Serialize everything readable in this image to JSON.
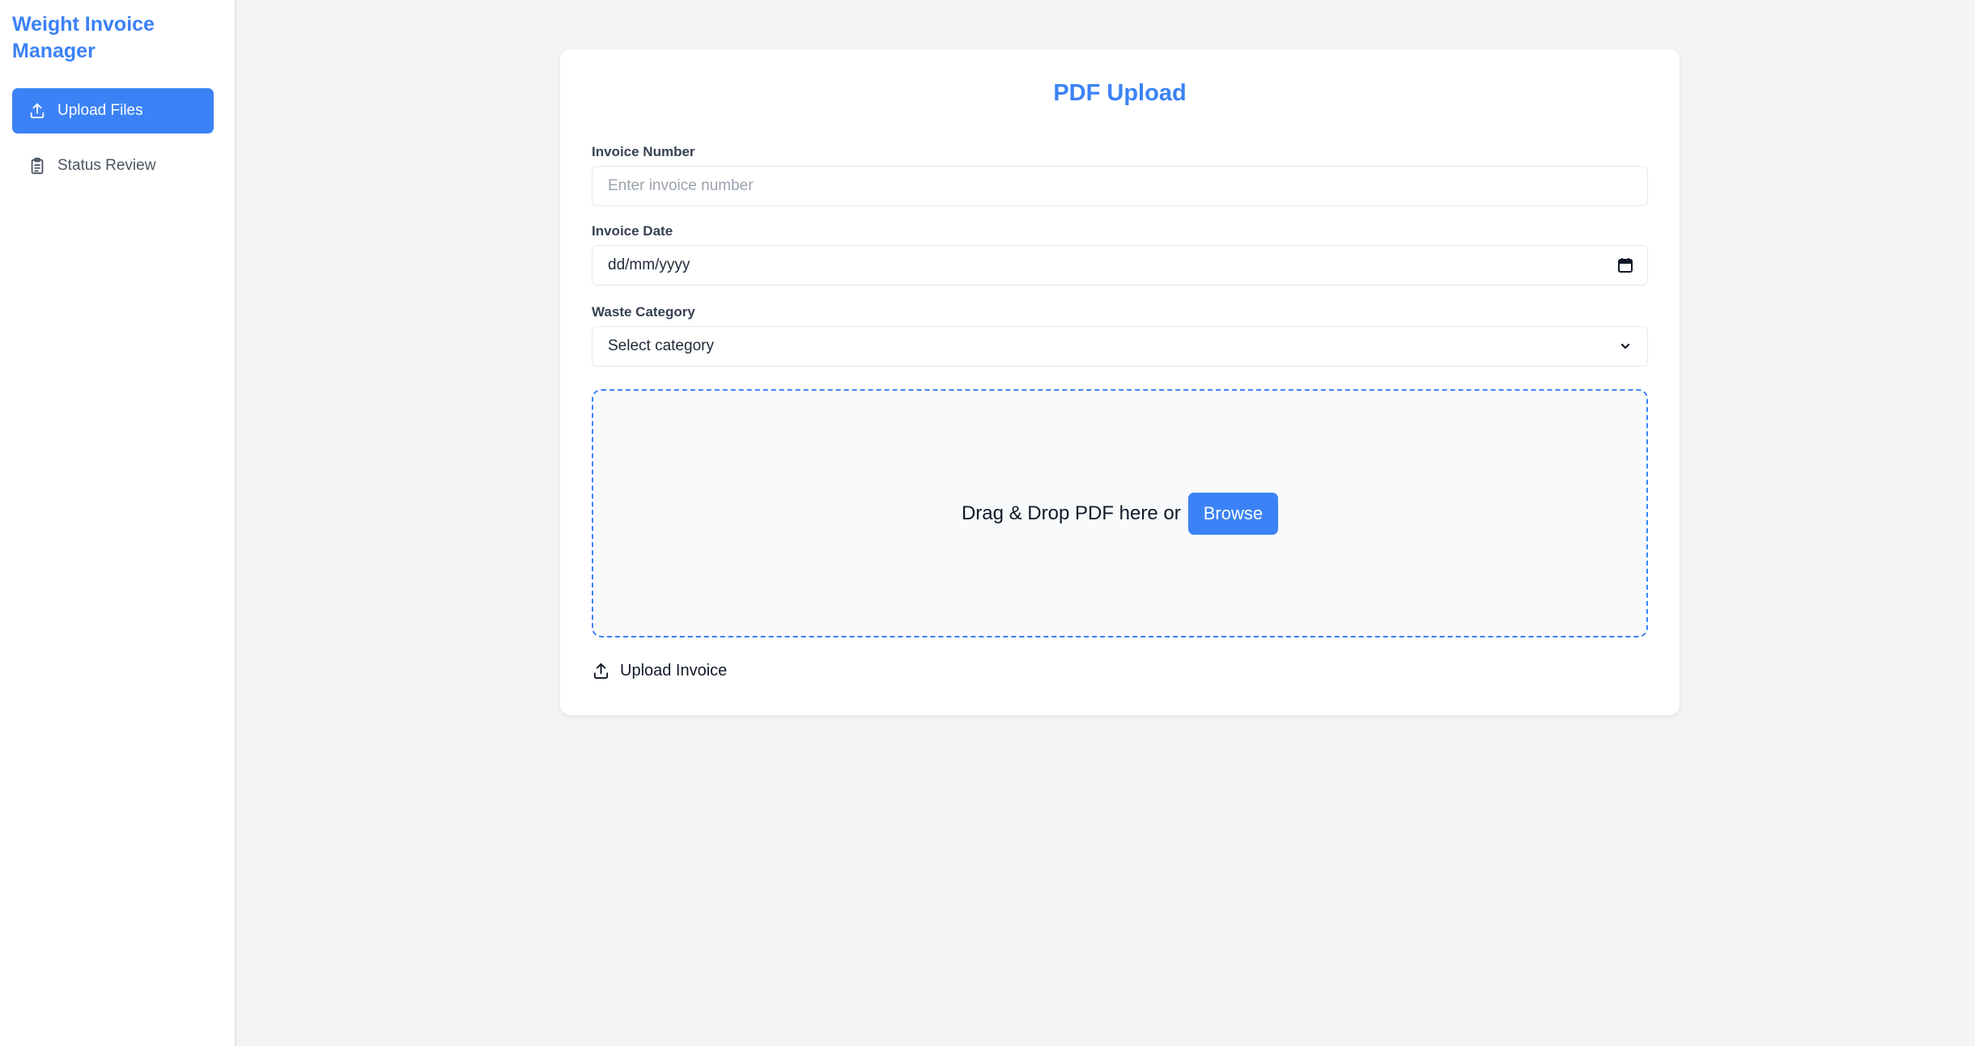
{
  "sidebar": {
    "brand": "Weight Invoice Manager",
    "items": [
      {
        "label": "Upload Files",
        "icon": "upload-icon",
        "active": true
      },
      {
        "label": "Status Review",
        "icon": "clipboard-icon",
        "active": false
      }
    ]
  },
  "form": {
    "title": "PDF Upload",
    "invoice_number": {
      "label": "Invoice Number",
      "placeholder": "Enter invoice number",
      "value": ""
    },
    "invoice_date": {
      "label": "Invoice Date",
      "value": "dd/mm/yyyy",
      "icon": "calendar-icon"
    },
    "waste_category": {
      "label": "Waste Category",
      "selected": "Select category",
      "icon": "chevron-down-icon"
    },
    "dropzone": {
      "text": "Drag & Drop PDF here or",
      "browse_label": "Browse"
    },
    "upload_action": {
      "label": "Upload Invoice",
      "icon": "upload-icon"
    }
  },
  "colors": {
    "accent": "#3b82f6",
    "background": "#f3f4f6",
    "card": "#ffffff",
    "dropzone_bg": "#f8fafc"
  }
}
